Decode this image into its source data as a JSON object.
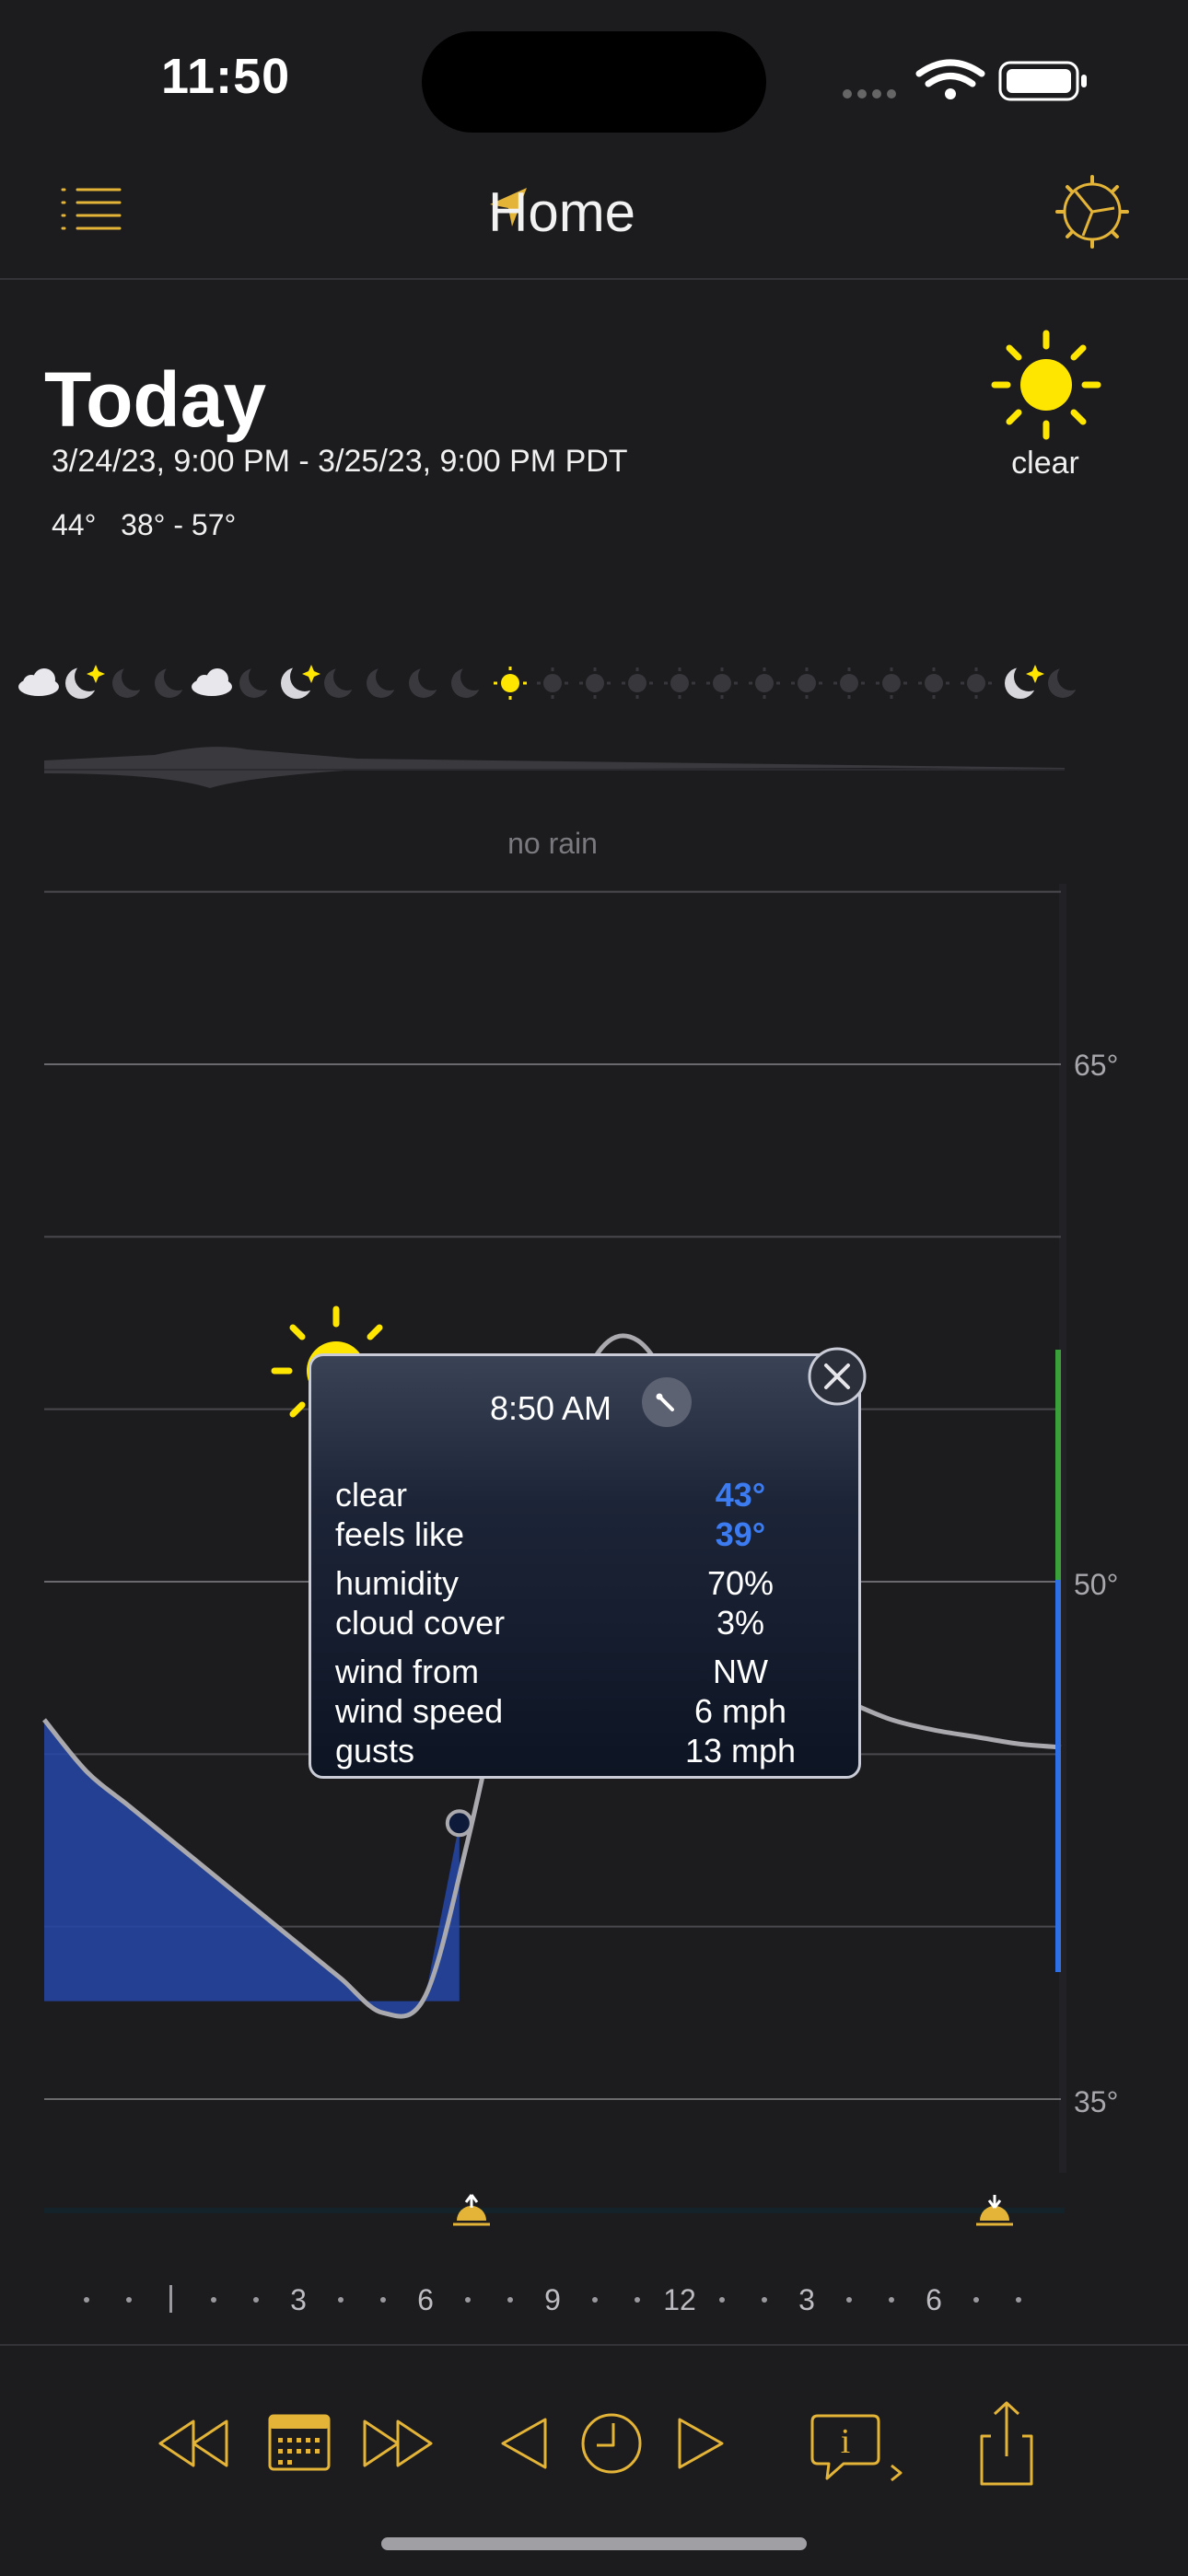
{
  "status_bar": {
    "time": "11:50"
  },
  "nav": {
    "title": "Home",
    "icons": [
      "list-icon",
      "location-arrow-icon",
      "settings-dial-icon"
    ]
  },
  "summary": {
    "title": "Today",
    "date_range": "3/24/23, 9:00 PM - 3/25/23, 9:00 PM PDT",
    "current_temp": "44°",
    "temp_range": "38° - 57°",
    "condition": "clear",
    "condition_icon": "sun-icon"
  },
  "precipitation": {
    "label": "no rain"
  },
  "chart_data": {
    "type": "line",
    "y_ticks": [
      "65°",
      "50°",
      "35°"
    ],
    "ylim": [
      35,
      65
    ],
    "x_tick_labels": [
      "3",
      "6",
      "9",
      "12",
      "3",
      "6"
    ],
    "series": [
      {
        "x": [
          0,
          1,
          2,
          3,
          4,
          5,
          6,
          7,
          8,
          9,
          10,
          11,
          12,
          13,
          14,
          15,
          16,
          17,
          18,
          19,
          20,
          21,
          22,
          23,
          24
        ],
        "values": [
          46,
          44.5,
          43.5,
          42.5,
          41.5,
          40.5,
          39.5,
          38.5,
          37.5,
          38,
          42.5,
          48,
          53,
          56.5,
          57,
          55,
          51,
          48,
          47,
          46.5,
          46,
          45.7,
          45.5,
          45.3,
          45.2
        ]
      }
    ],
    "highlight": {
      "time": "8:50 AM",
      "temp": 43
    },
    "grid": true
  },
  "tooltip": {
    "time": "8:50 AM",
    "rows": [
      {
        "label": "clear",
        "value": "43°",
        "accent": "#3c7cf0"
      },
      {
        "label": "feels like",
        "value": "39°",
        "accent": "#3c7cf0"
      },
      {
        "label": "humidity",
        "value": "70%"
      },
      {
        "label": "cloud cover",
        "value": "3%"
      },
      {
        "label": "wind from",
        "value": "NW"
      },
      {
        "label": "wind speed",
        "value": "6 mph"
      },
      {
        "label": "gusts",
        "value": "13 mph"
      }
    ]
  },
  "timeline": {
    "hour_labels": [
      "3",
      "6",
      "9",
      "12",
      "3",
      "6"
    ]
  },
  "toolbar": {
    "buttons": [
      "rewind-icon",
      "calendar-icon",
      "fast-forward-icon",
      "step-back-icon",
      "clock-icon",
      "step-forward-icon",
      "info-message-icon",
      "share-icon"
    ]
  },
  "colors": {
    "accent": "#e3b437",
    "sun": "#ffe600",
    "chart_fill": "#2546a8",
    "blue_line": "#2f6fe6",
    "green_line": "#3aa13a"
  }
}
